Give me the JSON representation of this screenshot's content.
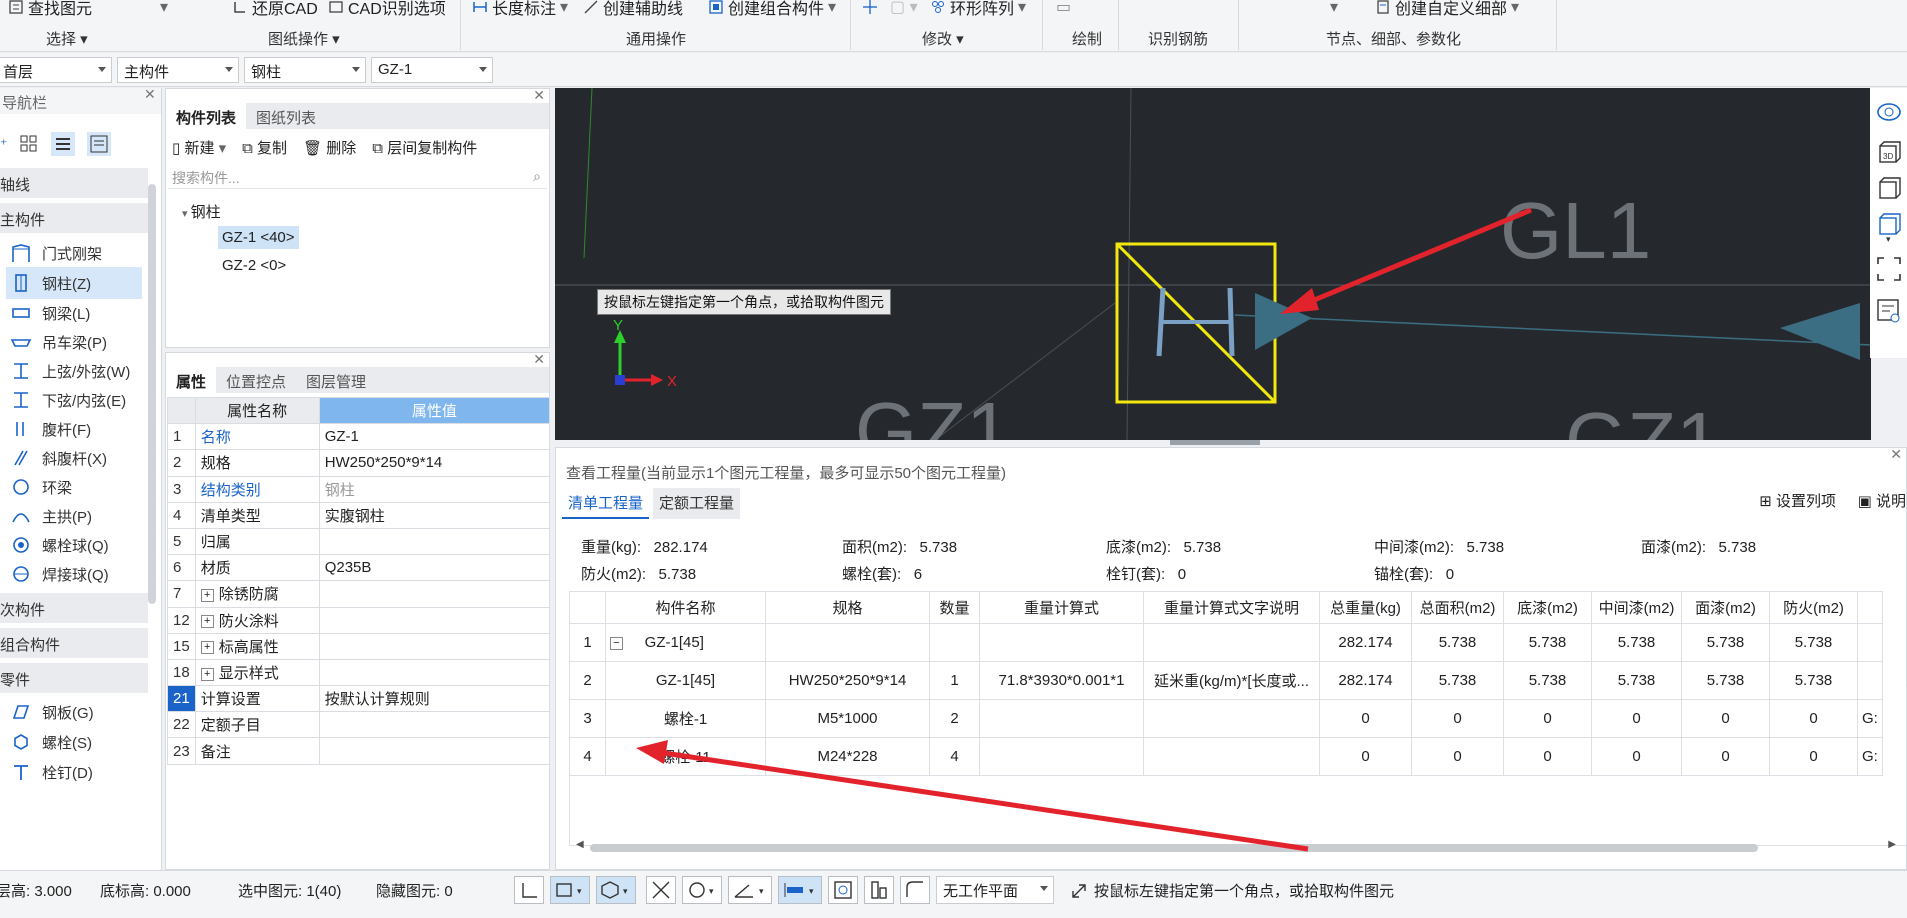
{
  "ribbon": {
    "items": [
      "查找图元",
      "还原CAD",
      "CAD识别选项",
      "长度标注",
      "创建辅助线",
      "创建组合构件",
      "环形阵列",
      "创建自定义细部"
    ],
    "groups": [
      "选择",
      "图纸操作",
      "通用操作",
      "修改",
      "绘制",
      "识别钢筋",
      "节点、细部、参数化"
    ]
  },
  "selectors": {
    "floor": "首层",
    "category": "主构件",
    "type": "钢柱",
    "item": "GZ-1"
  },
  "nav": {
    "title": "导航栏",
    "groups": [
      "轴线",
      "主构件",
      "次构件",
      "组合构件",
      "零件"
    ],
    "items": [
      "门式刚架",
      "钢柱(Z)",
      "钢梁(L)",
      "吊车梁(P)",
      "上弦/外弦(W)",
      "下弦/内弦(E)",
      "腹杆(F)",
      "斜腹杆(X)",
      "环梁",
      "主拱(P)",
      "螺栓球(Q)",
      "焊接球(Q)"
    ],
    "parts": [
      "钢板(G)",
      "螺栓(S)",
      "栓钉(D)"
    ]
  },
  "components": {
    "tabs": [
      "构件列表",
      "图纸列表"
    ],
    "toolbar": [
      "新建",
      "复制",
      "删除",
      "层间复制构件"
    ],
    "search_placeholder": "搜索构件...",
    "tree_root": "钢柱",
    "items": [
      "GZ-1 <40>",
      "GZ-2 <0>"
    ]
  },
  "properties": {
    "tabs": [
      "属性",
      "位置控点",
      "图层管理"
    ],
    "headers": [
      "属性名称",
      "属性值"
    ],
    "rows": [
      {
        "n": "1",
        "k": "名称",
        "v": "GZ-1"
      },
      {
        "n": "2",
        "k": "规格",
        "v": "HW250*250*9*14"
      },
      {
        "n": "3",
        "k": "结构类别",
        "v": "钢柱"
      },
      {
        "n": "4",
        "k": "清单类型",
        "v": "实腹钢柱"
      },
      {
        "n": "5",
        "k": "归属",
        "v": ""
      },
      {
        "n": "6",
        "k": "材质",
        "v": "Q235B"
      },
      {
        "n": "7",
        "k": "除锈防腐",
        "v": ""
      },
      {
        "n": "12",
        "k": "防火涂料",
        "v": ""
      },
      {
        "n": "15",
        "k": "标高属性",
        "v": ""
      },
      {
        "n": "18",
        "k": "显示样式",
        "v": ""
      },
      {
        "n": "21",
        "k": "计算设置",
        "v": "按默认计算规则"
      },
      {
        "n": "22",
        "k": "定额子目",
        "v": ""
      },
      {
        "n": "23",
        "k": "备注",
        "v": ""
      }
    ]
  },
  "canvas": {
    "tooltip": "按鼠标左键指定第一个角点，或拾取构件图元",
    "label_gl1": "GL1",
    "label_gz1": "GZ1",
    "axis_x": "X",
    "axis_y": "Y"
  },
  "quantities": {
    "title": "查看工程量(当前显示1个图元工程量，最多可显示50个图元工程量)",
    "tabs": [
      "清单工程量",
      "定额工程量"
    ],
    "actions": [
      "设置列项",
      "说明"
    ],
    "summary": [
      {
        "label": "重量(kg):",
        "value": "282.174"
      },
      {
        "label": "面积(m2):",
        "value": "5.738"
      },
      {
        "label": "底漆(m2):",
        "value": "5.738"
      },
      {
        "label": "中间漆(m2):",
        "value": "5.738"
      },
      {
        "label": "面漆(m2):",
        "value": "5.738"
      },
      {
        "label": "防火(m2):",
        "value": "5.738"
      },
      {
        "label": "螺栓(套):",
        "value": "6"
      },
      {
        "label": "栓钉(套):",
        "value": "0"
      },
      {
        "label": "锚栓(套):",
        "value": "0"
      }
    ],
    "columns": [
      "构件名称",
      "规格",
      "数量",
      "重量计算式",
      "重量计算式文字说明",
      "总重量(kg)",
      "总面积(m2)",
      "底漆(m2)",
      "中间漆(m2)",
      "面漆(m2)",
      "防火(m2)"
    ],
    "rows": [
      [
        "1",
        "GZ-1[45]",
        "",
        "",
        "",
        "",
        "282.174",
        "5.738",
        "5.738",
        "5.738",
        "5.738",
        "5.738"
      ],
      [
        "2",
        "GZ-1[45]",
        "HW250*250*9*14",
        "1",
        "71.8*3930*0.001*1",
        "延米重(kg/m)*[长度或...",
        "282.174",
        "5.738",
        "5.738",
        "5.738",
        "5.738",
        "5.738"
      ],
      [
        "3",
        "螺栓-1",
        "M5*1000",
        "2",
        "",
        "",
        "0",
        "0",
        "0",
        "0",
        "0",
        "0"
      ],
      [
        "4",
        "螺栓-11",
        "M24*228",
        "4",
        "",
        "",
        "0",
        "0",
        "0",
        "0",
        "0",
        "0"
      ]
    ],
    "row_edge": "G:"
  },
  "status": {
    "floor_height": "层高: 3.000",
    "base_height": "底标高: 0.000",
    "selected": "选中图元: 1(40)",
    "hidden": "隐藏图元: 0",
    "plane": "无工作平面",
    "hint": "按鼠标左键指定第一个角点，或拾取构件图元"
  },
  "colors": {
    "accent": "#1a63c9",
    "canvas_bg": "#25292e",
    "highlight": "#f2e70f",
    "arrow": "#e3232c",
    "marker": "#3b6e82"
  }
}
